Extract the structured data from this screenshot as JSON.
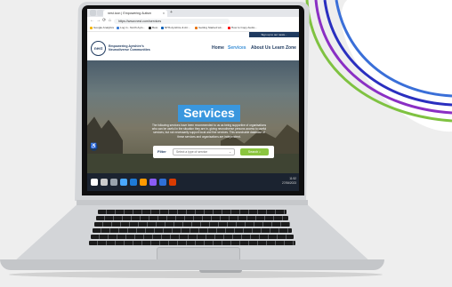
{
  "decoration": {
    "blob_color": "#ffffff",
    "line_colors": [
      "#3a6fd8",
      "#8a2fc4",
      "#2a2fbf",
      "#7fc241"
    ]
  },
  "browser": {
    "tab_title": "nest.icon | Empowering Autism",
    "tab_close": "×",
    "new_tab": "+",
    "url": "https://www.nest.com/services",
    "back": "←",
    "forward": "→",
    "reload": "⟳",
    "home": "⌂",
    "bookmarks": [
      {
        "label": "Google Analytics",
        "color": "#f4b400"
      },
      {
        "label": "Log in - North Ayrs...",
        "color": "#3a7bd5"
      },
      {
        "label": "Beto",
        "color": "#222"
      },
      {
        "label": "NHS Ayrshire & Arr...",
        "color": "#005eb8"
      },
      {
        "label": "Getting Started wit...",
        "color": "#e8710a"
      },
      {
        "label": "How to Copy Audio...",
        "color": "#ff0000"
      }
    ]
  },
  "site": {
    "promo_text": "Sign up to our news...",
    "logo_text": "nest",
    "tagline_line1": "Empowering Ayrshire's",
    "tagline_line2": "Neurodiverse Communities",
    "nav": [
      {
        "label": "Home",
        "active": false
      },
      {
        "label": "Services",
        "active": true
      },
      {
        "label": "About Us",
        "active": false
      },
      {
        "label": "Learn Zone",
        "active": false
      }
    ],
    "hero_title": "Services",
    "hero_text": "The following services have been recommended to us as being supportive of organisations who can be useful in the situation they are in, giving neurodiverse persons access to useful services, but not necessarily support local and fine services. This searchable database of these services and organisations are independent.",
    "filter_label": "Filter",
    "filter_placeholder": "Select a type of service",
    "filter_chevron": "⌄",
    "search_label": "Search ⌕",
    "accessibility_glyph": "♿"
  },
  "taskbar": {
    "time": "11:52",
    "date": "27/06/2023",
    "icon_colors": [
      "#ffffff",
      "#cccccc",
      "#9aa3ad",
      "#4aa8ff",
      "#1e7bd8",
      "#ff9a00",
      "#8a5cf5",
      "#2f6fd6",
      "#d83b01"
    ]
  }
}
